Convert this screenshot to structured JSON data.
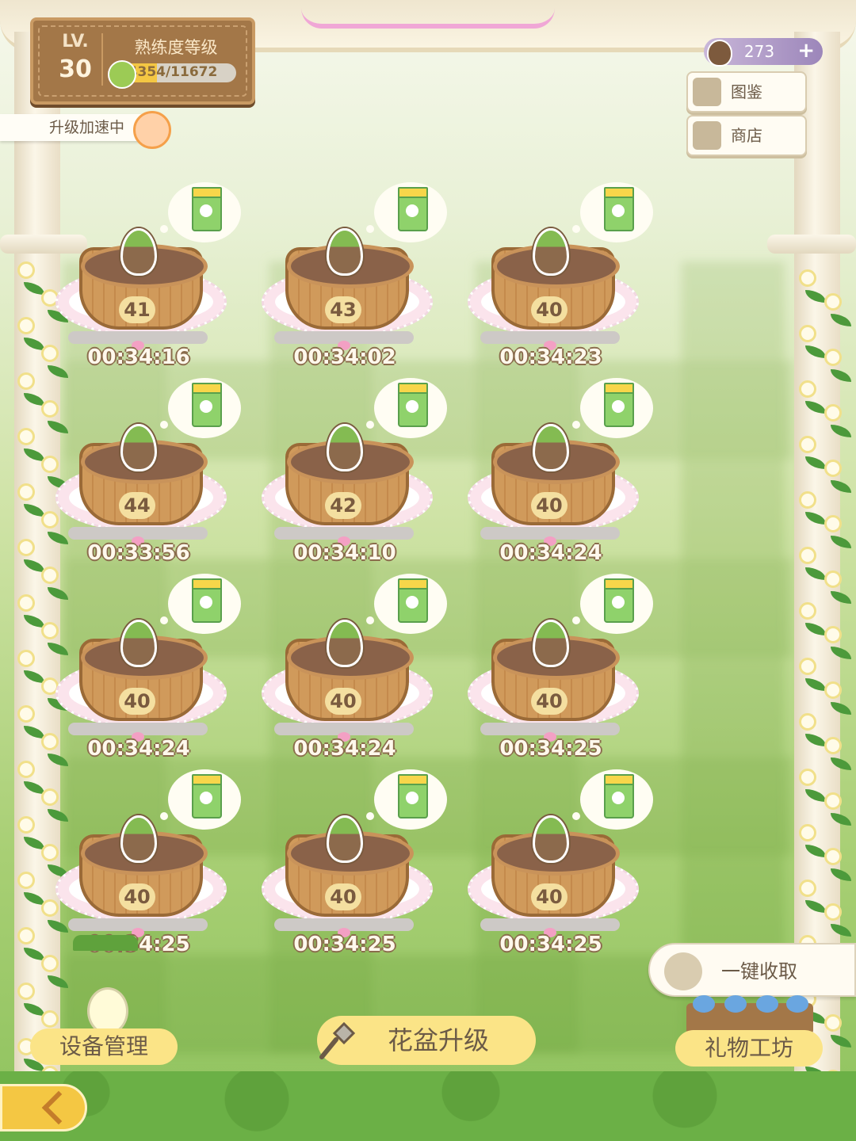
{
  "level_panel": {
    "lv_label": "LV.",
    "level": "30",
    "title": "熟练度等级",
    "exp_text": "4354/11672",
    "exp_fraction": 0.373
  },
  "speedup": {
    "label": "升级加速中"
  },
  "currency": {
    "seed_count": "273",
    "add_label": "+",
    "icon": "seed-icon"
  },
  "side_menu": {
    "catalog_label": "图鉴",
    "shop_label": "商店"
  },
  "pots": [
    {
      "level": "41",
      "timer": "00:34:16"
    },
    {
      "level": "43",
      "timer": "00:34:02"
    },
    {
      "level": "40",
      "timer": "00:34:23"
    },
    {
      "level": "44",
      "timer": "00:33:56"
    },
    {
      "level": "42",
      "timer": "00:34:10"
    },
    {
      "level": "40",
      "timer": "00:34:24"
    },
    {
      "level": "40",
      "timer": "00:34:24"
    },
    {
      "level": "40",
      "timer": "00:34:24"
    },
    {
      "level": "40",
      "timer": "00:34:25"
    },
    {
      "level": "40",
      "timer": "00:34:25"
    },
    {
      "level": "40",
      "timer": "00:34:25"
    },
    {
      "level": "40",
      "timer": "00:34:25"
    }
  ],
  "actions": {
    "harvest_all": "一键收取",
    "device_manage": "设备管理",
    "pot_upgrade": "花盆升级",
    "gift_workshop": "礼物工坊"
  },
  "colors": {
    "accent": "#fbe487",
    "wood": "#a37748",
    "back_button": "#f4c743"
  }
}
